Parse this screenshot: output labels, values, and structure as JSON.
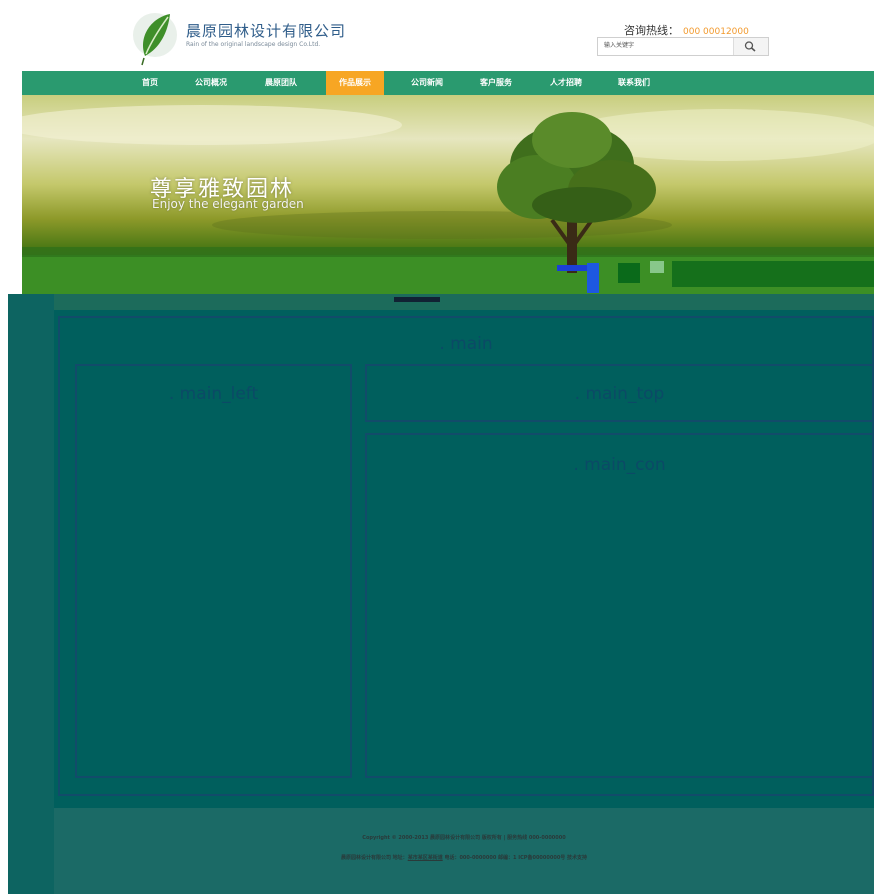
{
  "header": {
    "brand_cn": "晨原园林设计有限公司",
    "brand_en": "Rain of the original landscape design Co.Ltd.",
    "hotline_label": "咨询热线：",
    "hotline_number": "000 00012000",
    "search_placeholder": "输入关键字"
  },
  "nav": {
    "items": [
      {
        "label": "首页"
      },
      {
        "label": "公司概况"
      },
      {
        "label": "晨原团队"
      },
      {
        "label": "作品展示"
      },
      {
        "label": "公司新闻"
      },
      {
        "label": "客户服务"
      },
      {
        "label": "人才招聘"
      },
      {
        "label": "联系我们"
      }
    ],
    "active_index": 3
  },
  "banner": {
    "title_cn": "尊享雅致园林",
    "title_en": "Enjoy the elegant garden"
  },
  "layout": {
    "main": ". main",
    "main_left": ". main_left",
    "main_top": ". main_top",
    "main_con": ". main_con"
  },
  "footer": {
    "line1": "Copyright © 2000-2013 晨原园林设计有限公司 版权所有 | 服务热线 000-0000000",
    "line2_prefix": "晨原园林设计有限公司 地址：",
    "line2_link": "某市某区某街道",
    "line2_suffix": " 电话：000-0000000 邮编：1 ICP备00000000号 技术支持"
  },
  "colors": {
    "nav_bg": "#2a9a6f",
    "nav_active": "#f7a623",
    "hotline": "#f29a2e",
    "panel_bg": "#0d6461",
    "panel_border": "#124b6a"
  }
}
